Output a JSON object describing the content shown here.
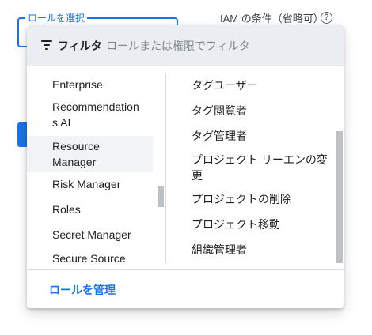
{
  "background": {
    "role_select_label": "ロールを選択",
    "iam_condition": "IAM の条件（省略可）",
    "help_icon": "?"
  },
  "filter": {
    "label": "フィルタ",
    "placeholder": "ロールまたは権限でフィルタ",
    "value": ""
  },
  "services": [
    "Enterprise",
    "Recommendations AI",
    "Resource Manager",
    "Risk Manager",
    "Roles",
    "Secret Manager",
    "Secure Source"
  ],
  "selected_service": "Resource Manager",
  "roles": [
    "タグユーザー",
    "タグ閲覧者",
    "タグ管理者",
    "プロジェクト リーエンの変更",
    "プロジェクトの削除",
    "プロジェクト移動",
    "組織管理者"
  ],
  "footer": {
    "manage_roles": "ロールを管理"
  },
  "colors": {
    "accent": "#1a73e8",
    "filter_bar_bg": "#eaedf1",
    "selected_item_bg": "#f1f3f4"
  }
}
